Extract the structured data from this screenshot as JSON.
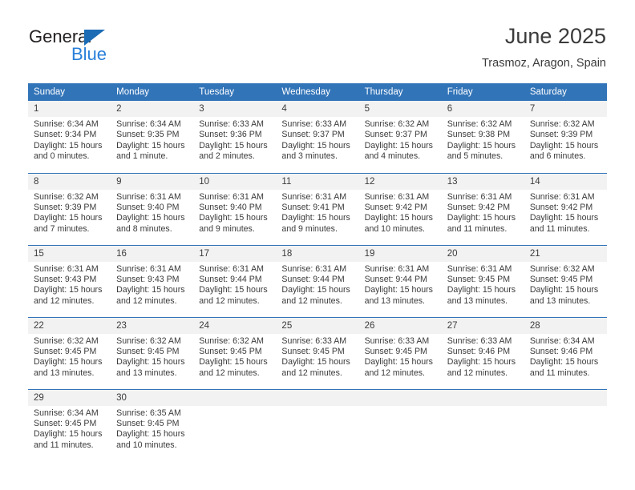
{
  "brand": {
    "name_top": "General",
    "name_bottom": "Blue",
    "triangle_color": "#1c6cb5",
    "text_top_color": "#231f20",
    "text_bottom_color": "#2980d9"
  },
  "header": {
    "title": "June 2025",
    "subtitle": "Trasmoz, Aragon, Spain"
  },
  "theme": {
    "header_bar_color": "#3274b8",
    "daynum_bg": "#f2f2f2",
    "text_color": "#3b3b3b",
    "row_rule_color": "#3274b8"
  },
  "weekdays": [
    "Sunday",
    "Monday",
    "Tuesday",
    "Wednesday",
    "Thursday",
    "Friday",
    "Saturday"
  ],
  "weeks": [
    [
      {
        "day": "1",
        "sunrise": "Sunrise: 6:34 AM",
        "sunset": "Sunset: 9:34 PM",
        "daylight1": "Daylight: 15 hours",
        "daylight2": "and 0 minutes."
      },
      {
        "day": "2",
        "sunrise": "Sunrise: 6:34 AM",
        "sunset": "Sunset: 9:35 PM",
        "daylight1": "Daylight: 15 hours",
        "daylight2": "and 1 minute."
      },
      {
        "day": "3",
        "sunrise": "Sunrise: 6:33 AM",
        "sunset": "Sunset: 9:36 PM",
        "daylight1": "Daylight: 15 hours",
        "daylight2": "and 2 minutes."
      },
      {
        "day": "4",
        "sunrise": "Sunrise: 6:33 AM",
        "sunset": "Sunset: 9:37 PM",
        "daylight1": "Daylight: 15 hours",
        "daylight2": "and 3 minutes."
      },
      {
        "day": "5",
        "sunrise": "Sunrise: 6:32 AM",
        "sunset": "Sunset: 9:37 PM",
        "daylight1": "Daylight: 15 hours",
        "daylight2": "and 4 minutes."
      },
      {
        "day": "6",
        "sunrise": "Sunrise: 6:32 AM",
        "sunset": "Sunset: 9:38 PM",
        "daylight1": "Daylight: 15 hours",
        "daylight2": "and 5 minutes."
      },
      {
        "day": "7",
        "sunrise": "Sunrise: 6:32 AM",
        "sunset": "Sunset: 9:39 PM",
        "daylight1": "Daylight: 15 hours",
        "daylight2": "and 6 minutes."
      }
    ],
    [
      {
        "day": "8",
        "sunrise": "Sunrise: 6:32 AM",
        "sunset": "Sunset: 9:39 PM",
        "daylight1": "Daylight: 15 hours",
        "daylight2": "and 7 minutes."
      },
      {
        "day": "9",
        "sunrise": "Sunrise: 6:31 AM",
        "sunset": "Sunset: 9:40 PM",
        "daylight1": "Daylight: 15 hours",
        "daylight2": "and 8 minutes."
      },
      {
        "day": "10",
        "sunrise": "Sunrise: 6:31 AM",
        "sunset": "Sunset: 9:40 PM",
        "daylight1": "Daylight: 15 hours",
        "daylight2": "and 9 minutes."
      },
      {
        "day": "11",
        "sunrise": "Sunrise: 6:31 AM",
        "sunset": "Sunset: 9:41 PM",
        "daylight1": "Daylight: 15 hours",
        "daylight2": "and 9 minutes."
      },
      {
        "day": "12",
        "sunrise": "Sunrise: 6:31 AM",
        "sunset": "Sunset: 9:42 PM",
        "daylight1": "Daylight: 15 hours",
        "daylight2": "and 10 minutes."
      },
      {
        "day": "13",
        "sunrise": "Sunrise: 6:31 AM",
        "sunset": "Sunset: 9:42 PM",
        "daylight1": "Daylight: 15 hours",
        "daylight2": "and 11 minutes."
      },
      {
        "day": "14",
        "sunrise": "Sunrise: 6:31 AM",
        "sunset": "Sunset: 9:42 PM",
        "daylight1": "Daylight: 15 hours",
        "daylight2": "and 11 minutes."
      }
    ],
    [
      {
        "day": "15",
        "sunrise": "Sunrise: 6:31 AM",
        "sunset": "Sunset: 9:43 PM",
        "daylight1": "Daylight: 15 hours",
        "daylight2": "and 12 minutes."
      },
      {
        "day": "16",
        "sunrise": "Sunrise: 6:31 AM",
        "sunset": "Sunset: 9:43 PM",
        "daylight1": "Daylight: 15 hours",
        "daylight2": "and 12 minutes."
      },
      {
        "day": "17",
        "sunrise": "Sunrise: 6:31 AM",
        "sunset": "Sunset: 9:44 PM",
        "daylight1": "Daylight: 15 hours",
        "daylight2": "and 12 minutes."
      },
      {
        "day": "18",
        "sunrise": "Sunrise: 6:31 AM",
        "sunset": "Sunset: 9:44 PM",
        "daylight1": "Daylight: 15 hours",
        "daylight2": "and 12 minutes."
      },
      {
        "day": "19",
        "sunrise": "Sunrise: 6:31 AM",
        "sunset": "Sunset: 9:44 PM",
        "daylight1": "Daylight: 15 hours",
        "daylight2": "and 13 minutes."
      },
      {
        "day": "20",
        "sunrise": "Sunrise: 6:31 AM",
        "sunset": "Sunset: 9:45 PM",
        "daylight1": "Daylight: 15 hours",
        "daylight2": "and 13 minutes."
      },
      {
        "day": "21",
        "sunrise": "Sunrise: 6:32 AM",
        "sunset": "Sunset: 9:45 PM",
        "daylight1": "Daylight: 15 hours",
        "daylight2": "and 13 minutes."
      }
    ],
    [
      {
        "day": "22",
        "sunrise": "Sunrise: 6:32 AM",
        "sunset": "Sunset: 9:45 PM",
        "daylight1": "Daylight: 15 hours",
        "daylight2": "and 13 minutes."
      },
      {
        "day": "23",
        "sunrise": "Sunrise: 6:32 AM",
        "sunset": "Sunset: 9:45 PM",
        "daylight1": "Daylight: 15 hours",
        "daylight2": "and 13 minutes."
      },
      {
        "day": "24",
        "sunrise": "Sunrise: 6:32 AM",
        "sunset": "Sunset: 9:45 PM",
        "daylight1": "Daylight: 15 hours",
        "daylight2": "and 12 minutes."
      },
      {
        "day": "25",
        "sunrise": "Sunrise: 6:33 AM",
        "sunset": "Sunset: 9:45 PM",
        "daylight1": "Daylight: 15 hours",
        "daylight2": "and 12 minutes."
      },
      {
        "day": "26",
        "sunrise": "Sunrise: 6:33 AM",
        "sunset": "Sunset: 9:45 PM",
        "daylight1": "Daylight: 15 hours",
        "daylight2": "and 12 minutes."
      },
      {
        "day": "27",
        "sunrise": "Sunrise: 6:33 AM",
        "sunset": "Sunset: 9:46 PM",
        "daylight1": "Daylight: 15 hours",
        "daylight2": "and 12 minutes."
      },
      {
        "day": "28",
        "sunrise": "Sunrise: 6:34 AM",
        "sunset": "Sunset: 9:46 PM",
        "daylight1": "Daylight: 15 hours",
        "daylight2": "and 11 minutes."
      }
    ],
    [
      {
        "day": "29",
        "sunrise": "Sunrise: 6:34 AM",
        "sunset": "Sunset: 9:45 PM",
        "daylight1": "Daylight: 15 hours",
        "daylight2": "and 11 minutes."
      },
      {
        "day": "30",
        "sunrise": "Sunrise: 6:35 AM",
        "sunset": "Sunset: 9:45 PM",
        "daylight1": "Daylight: 15 hours",
        "daylight2": "and 10 minutes."
      },
      {
        "day": "",
        "sunrise": "",
        "sunset": "",
        "daylight1": "",
        "daylight2": ""
      },
      {
        "day": "",
        "sunrise": "",
        "sunset": "",
        "daylight1": "",
        "daylight2": ""
      },
      {
        "day": "",
        "sunrise": "",
        "sunset": "",
        "daylight1": "",
        "daylight2": ""
      },
      {
        "day": "",
        "sunrise": "",
        "sunset": "",
        "daylight1": "",
        "daylight2": ""
      },
      {
        "day": "",
        "sunrise": "",
        "sunset": "",
        "daylight1": "",
        "daylight2": ""
      }
    ]
  ]
}
